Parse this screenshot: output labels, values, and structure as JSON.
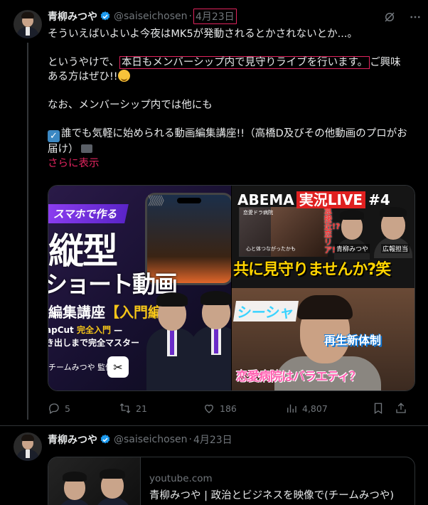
{
  "post1": {
    "name": "青柳みつや",
    "handle": "@saiseichosen",
    "dot": "·",
    "date": "4月23日",
    "lines": {
      "l1": "そういえばいよいよ今夜はMK5が発動されるとかされないとか...。",
      "l2_pre": "というやけで、",
      "l2_box": "本日もメンバーシップ内で見守りライブを行います。",
      "l2_post": "ご興味",
      "l3": "ある方はぜひ!!",
      "l4": "なお、メンバーシップ内では他にも",
      "l5": "誰でも気軽に始められる動画編集講座!!（高橋D及びその他動画のプロがお",
      "l6": "届け）"
    },
    "show_more": "さらに表示",
    "media_left": {
      "badge": "スマホで作る",
      "arrows": "》》》》",
      "title1": "縦型",
      "title2": "ショート動画",
      "title3": "編集講座",
      "title3_bracket": "【入門編】",
      "line_a_pre": "apCut",
      "line_a_yel": "完全入門",
      "line_a_post": "—",
      "line_b": "き出しまで完全マスター",
      "team": "チームみつや 監修"
    },
    "media_rt": {
      "abema": "ABEMA",
      "live": "実況LIVE",
      "num": "#4",
      "tag": "恋愛ドラ病院",
      "cap": "心と体つながったかも",
      "vert": "急接近!?恋リア!",
      "name1": "青柳みつや",
      "name2": "広報担当",
      "headline": "共に見守りませんか?笑"
    },
    "media_rb": {
      "shisha": "シーシャ",
      "saisei": "再生新体制",
      "renai": "恋愛病院はバラエティ？"
    },
    "actions": {
      "replies": "5",
      "reposts": "21",
      "likes": "186",
      "views": "4,807"
    }
  },
  "post2": {
    "name": "青柳みつや",
    "handle": "@saiseichosen",
    "dot": "·",
    "date": "4月23日",
    "card": {
      "domain": "youtube.com",
      "title": "青柳みつや | 政治とビジネスを映像で(チームみつや)"
    }
  },
  "icons": {
    "verified": "verified-badge-icon",
    "grok": "grok-icon",
    "more": "more-icon",
    "reply": "reply-icon",
    "repost": "repost-icon",
    "like": "like-icon",
    "views": "views-icon",
    "bookmark": "bookmark-icon",
    "share": "share-icon"
  },
  "colors": {
    "background": "#000000",
    "text": "#e7e9ea",
    "muted": "#71767b",
    "verified": "#1d9bf0",
    "highlight_box": "#e0245e",
    "show_more": "#e0245e"
  }
}
